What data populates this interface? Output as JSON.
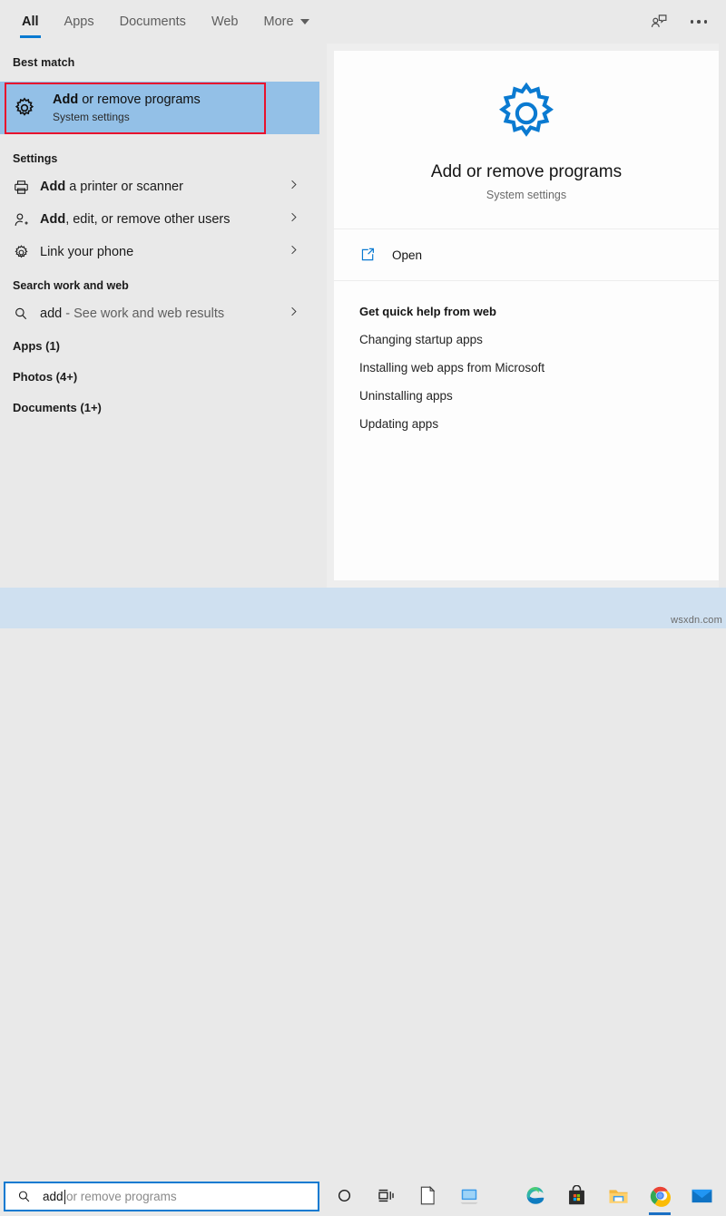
{
  "tabs": [
    {
      "label": "All",
      "active": true
    },
    {
      "label": "Apps",
      "active": false
    },
    {
      "label": "Documents",
      "active": false
    },
    {
      "label": "Web",
      "active": false
    },
    {
      "label": "More",
      "active": false,
      "caret": true
    }
  ],
  "top_actions": {
    "feedback_icon": "feedback-person-icon",
    "more_icon": "ellipsis-icon"
  },
  "left": {
    "best_match_header": "Best match",
    "best_match": {
      "icon": "gear-icon",
      "title_bold": "Add",
      "title_rest": " or remove programs",
      "subtitle": "System settings",
      "highlight_color": "#93c0e7",
      "annotation_color": "#e8112d"
    },
    "settings_header": "Settings",
    "settings_items": [
      {
        "icon": "printer-icon",
        "bold": "Add",
        "rest": " a printer or scanner"
      },
      {
        "icon": "add-user-icon",
        "bold": "Add",
        "rest": ", edit, or remove other users"
      },
      {
        "icon": "gear-icon",
        "bold": "",
        "rest": "Link your phone"
      }
    ],
    "web_header": "Search work and web",
    "web_item": {
      "icon": "search-icon",
      "query": "add",
      "suffix": " - See work and web results"
    },
    "categories": [
      {
        "label": "Apps (1)"
      },
      {
        "label": "Photos (4+)"
      },
      {
        "label": "Documents (1+)"
      }
    ]
  },
  "preview": {
    "icon": "gear-icon",
    "icon_color": "#0a7ad1",
    "title": "Add or remove programs",
    "subtitle": "System settings",
    "open_action": {
      "icon": "open-external-icon",
      "label": "Open"
    },
    "help_header": "Get quick help from web",
    "help_items": [
      "Changing startup apps",
      "Installing web apps from Microsoft",
      "Uninstalling apps",
      "Updating apps"
    ]
  },
  "taskbar": {
    "search": {
      "icon": "search-icon",
      "typed_value": "add",
      "suggestion": "or remove programs",
      "border_color": "#0a7ad1"
    },
    "items": [
      {
        "name": "cortana-icon"
      },
      {
        "name": "task-view-icon"
      },
      {
        "name": "document-icon"
      },
      {
        "name": "remote-desktop-icon"
      }
    ],
    "pinned": [
      {
        "name": "edge-icon",
        "active": false
      },
      {
        "name": "microsoft-store-icon",
        "active": false
      },
      {
        "name": "file-explorer-icon",
        "active": false
      },
      {
        "name": "chrome-icon",
        "active": true
      },
      {
        "name": "mail-icon",
        "active": false
      }
    ],
    "background_color": "#cfe0f0"
  },
  "watermark": "wsxdn.com"
}
